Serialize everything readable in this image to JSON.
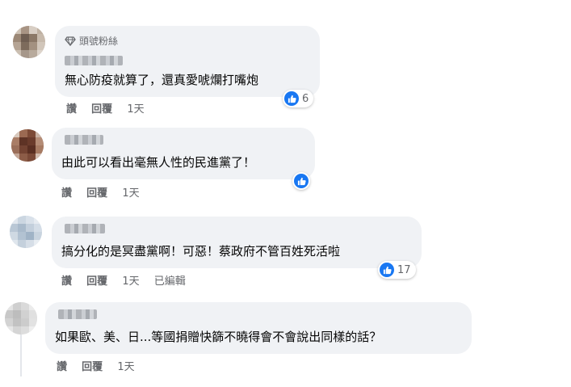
{
  "comments": [
    {
      "badge": "頭號粉絲",
      "text": "無心防疫就算了，還真愛唬爛打嘴炮",
      "actions": {
        "like": "讚",
        "reply": "回覆",
        "time": "1天"
      },
      "reactions": "6"
    },
    {
      "text": "由此可以看出毫無人性的民進黨了！",
      "actions": {
        "like": "讚",
        "reply": "回覆",
        "time": "1天"
      }
    },
    {
      "text": "搞分化的是冥盡黨啊！可惡！蔡政府不管百姓死活啦",
      "actions": {
        "like": "讚",
        "reply": "回覆",
        "time": "1天",
        "edited": "已編輯"
      },
      "reactions": "17"
    },
    {
      "text": "如果歐、美、日...等國捐贈快篩不曉得會不會說出同樣的話？",
      "actions": {
        "like": "讚",
        "reply": "回覆",
        "time": "1天"
      }
    }
  ],
  "colors": {
    "bubble": "#f0f2f5",
    "like_blue": "#1877f2",
    "meta_gray": "#65676b"
  },
  "icons": {
    "badge": "diamond-icon",
    "reaction": "like-thumb-icon"
  }
}
